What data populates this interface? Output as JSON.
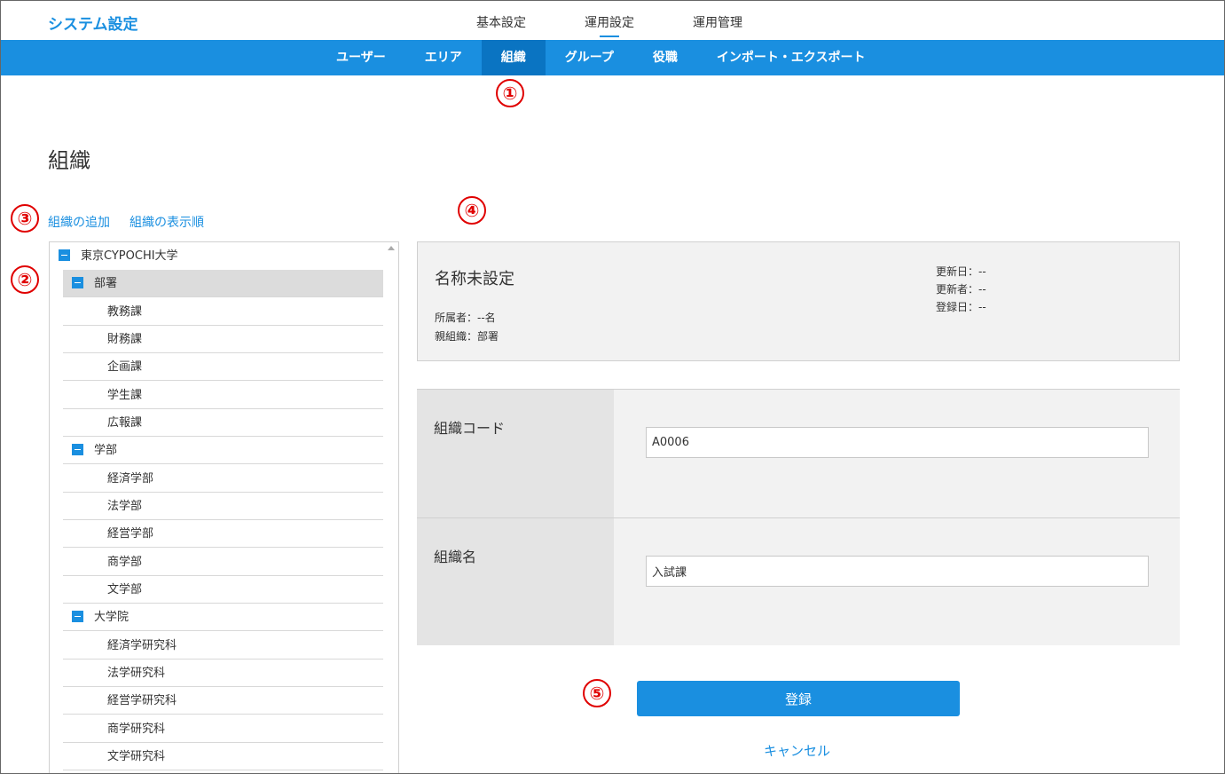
{
  "header": {
    "app_title": "システム設定",
    "top_nav": [
      "基本設定",
      "運用設定",
      "運用管理"
    ],
    "active_top_nav": "運用設定"
  },
  "sub_nav": {
    "items": [
      "ユーザー",
      "エリア",
      "組織",
      "グループ",
      "役職",
      "インポート・エクスポート"
    ],
    "active": "組織"
  },
  "markers": [
    "①",
    "②",
    "③",
    "④",
    "⑤"
  ],
  "page": {
    "title": "組織",
    "links": {
      "add": "組織の追加",
      "order": "組織の表示順"
    }
  },
  "tree": {
    "root": "東京CYPOCHI大学",
    "groups": [
      {
        "label": "部署",
        "children": [
          "教務課",
          "財務課",
          "企画課",
          "学生課",
          "広報課"
        ]
      },
      {
        "label": "学部",
        "children": [
          "経済学部",
          "法学部",
          "経営学部",
          "商学部",
          "文学部"
        ]
      },
      {
        "label": "大学院",
        "children": [
          "経済学研究科",
          "法学研究科",
          "経営学研究科",
          "商学研究科",
          "文学研究科"
        ]
      }
    ]
  },
  "info": {
    "name": "名称未設定",
    "members": "所属者：--名",
    "parent": "親組織：部署",
    "updated_date": "更新日：--",
    "updated_by": "更新者：--",
    "registered_date": "登録日：--"
  },
  "form": {
    "code_label": "組織コード",
    "code_value": "A0006",
    "name_label": "組織名",
    "name_value": "入試課"
  },
  "actions": {
    "submit": "登録",
    "cancel": "キャンセル"
  },
  "colors": {
    "accent": "#1a8fe0",
    "accent_dark": "#0a74c2",
    "marker": "#e00000"
  }
}
